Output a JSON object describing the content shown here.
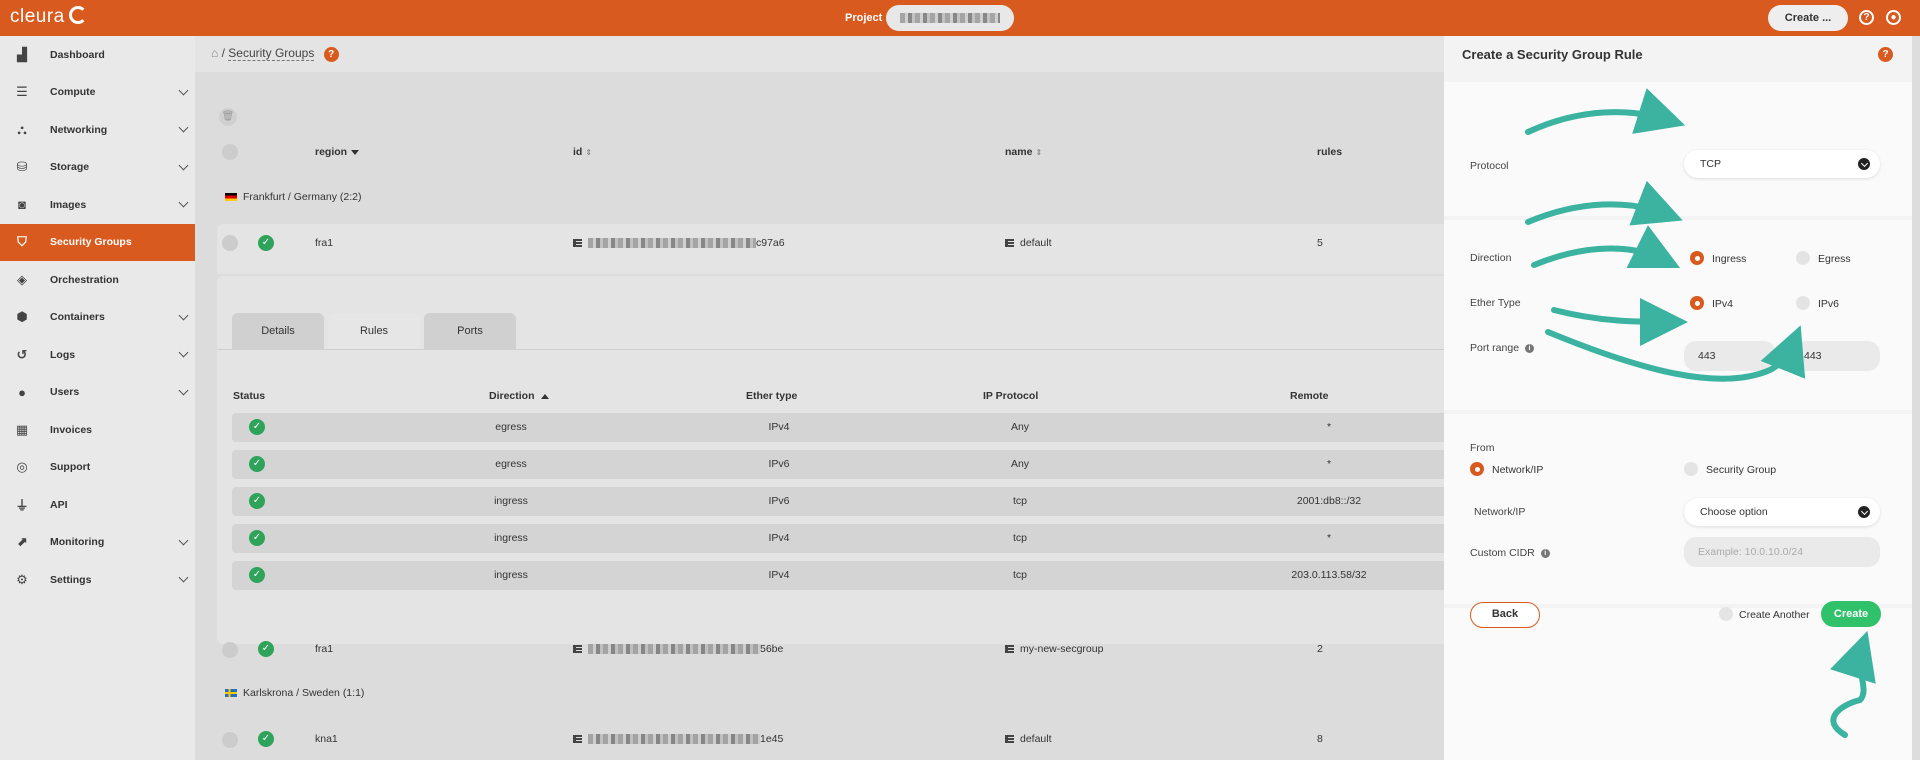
{
  "topbar": {
    "logo": "cleura",
    "project_label": "Project",
    "create_label": "Create ...",
    "help_icon": "help-icon",
    "user_icon": "user-icon"
  },
  "sidebar": {
    "items": [
      {
        "label": "Dashboard",
        "icon": "chart-area-icon",
        "chevron": false
      },
      {
        "label": "Compute",
        "icon": "server-icon",
        "chevron": true
      },
      {
        "label": "Networking",
        "icon": "network-icon",
        "chevron": true
      },
      {
        "label": "Storage",
        "icon": "database-icon",
        "chevron": true
      },
      {
        "label": "Images",
        "icon": "camera-icon",
        "chevron": true
      },
      {
        "label": "Security Groups",
        "icon": "shield-icon",
        "chevron": false,
        "active": true
      },
      {
        "label": "Orchestration",
        "icon": "layers-icon",
        "chevron": false
      },
      {
        "label": "Containers",
        "icon": "cube-icon",
        "chevron": true
      },
      {
        "label": "Logs",
        "icon": "history-icon",
        "chevron": true
      },
      {
        "label": "Users",
        "icon": "user-icon",
        "chevron": true
      },
      {
        "label": "Invoices",
        "icon": "calculator-icon",
        "chevron": false
      },
      {
        "label": "Support",
        "icon": "lifebuoy-icon",
        "chevron": false
      },
      {
        "label": "API",
        "icon": "plug-icon",
        "chevron": false
      },
      {
        "label": "Monitoring",
        "icon": "line-chart-icon",
        "chevron": true
      },
      {
        "label": "Settings",
        "icon": "gear-icon",
        "chevron": true
      }
    ]
  },
  "main": {
    "breadcrumb_sep": "/",
    "title": "Security Groups",
    "columns": {
      "region": "region",
      "id": "id",
      "name": "name",
      "rules": "rules"
    },
    "groups": [
      {
        "label": "Frankfurt / Germany",
        "count": "(2:2)"
      },
      {
        "label": "Karlskrona / Sweden",
        "count": "(1:1)"
      }
    ],
    "rows": [
      {
        "region": "fra1",
        "id_suffix": "c97a6",
        "name": "default",
        "rules": "5"
      },
      {
        "region": "fra1",
        "id_suffix": "56be",
        "name": "my-new-secgroup",
        "rules": "2"
      },
      {
        "region": "kna1",
        "id_suffix": "1e45",
        "name": "default",
        "rules": "8"
      }
    ],
    "tabs": [
      "Details",
      "Rules",
      "Ports"
    ],
    "rules_columns": {
      "status": "Status",
      "direction": "Direction",
      "ether": "Ether type",
      "proto": "IP Protocol",
      "remote": "Remote"
    },
    "rules": [
      {
        "direction": "egress",
        "ether": "IPv4",
        "proto": "Any",
        "remote": "*"
      },
      {
        "direction": "egress",
        "ether": "IPv6",
        "proto": "Any",
        "remote": "*"
      },
      {
        "direction": "ingress",
        "ether": "IPv6",
        "proto": "tcp",
        "remote": "2001:db8::/32"
      },
      {
        "direction": "ingress",
        "ether": "IPv4",
        "proto": "tcp",
        "remote": "*"
      },
      {
        "direction": "ingress",
        "ether": "IPv4",
        "proto": "tcp",
        "remote": "203.0.113.58/32"
      }
    ]
  },
  "panel": {
    "title": "Create a Security Group Rule",
    "protocol_label": "Protocol",
    "protocol_value": "TCP",
    "direction_label": "Direction",
    "direction_options": [
      "Ingress",
      "Egress"
    ],
    "direction_selected": "Ingress",
    "ether_label": "Ether Type",
    "ether_options": [
      "IPv4",
      "IPv6"
    ],
    "ether_selected": "IPv4",
    "port_range_label": "Port range",
    "port_from": "443",
    "port_to": "443",
    "from_label": "From",
    "from_options": [
      "Network/IP",
      "Security Group"
    ],
    "from_selected": "Network/IP",
    "network_label": "Network/IP",
    "network_value": "Choose option",
    "cidr_label": "Custom CIDR",
    "cidr_placeholder": "Example: 10.0.10.0/24",
    "back_label": "Back",
    "create_another_label": "Create Another",
    "create_label": "Create"
  },
  "colors": {
    "brand": "#d95a1e",
    "success": "#2fa35a",
    "create_button": "#2fc26b",
    "annotation_arrow": "#3bb3a0"
  }
}
